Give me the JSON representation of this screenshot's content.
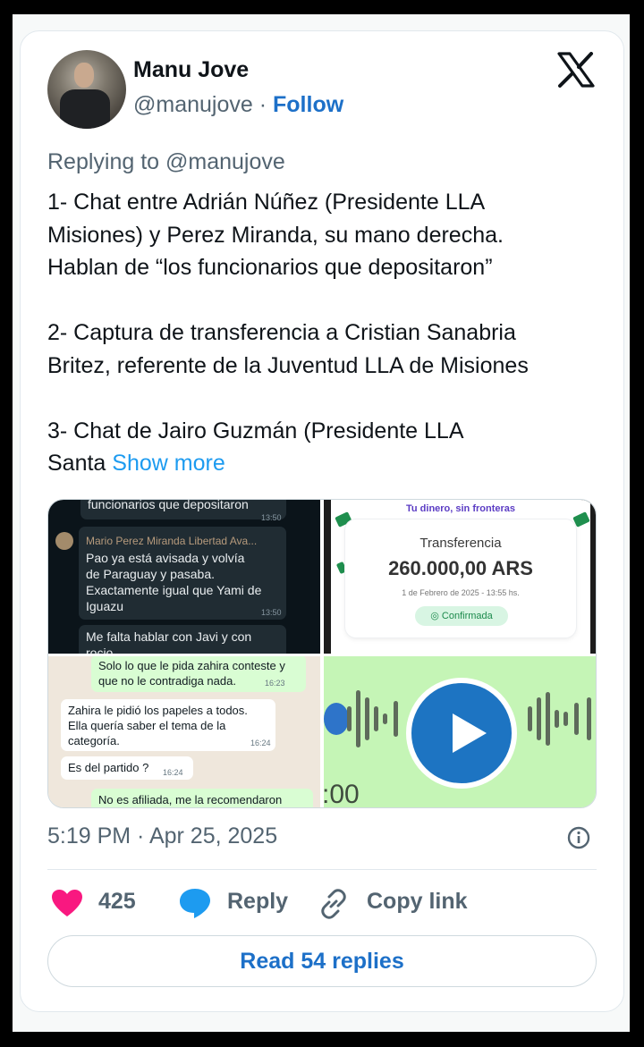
{
  "author": {
    "name": "Manu Jove",
    "handle": "@manujove",
    "separator": "·",
    "follow_label": "Follow"
  },
  "logo_icon": "x-logo-icon",
  "replying_to": "Replying to @manujove",
  "text": {
    "line1": "1- Chat entre Adrián Núñez (Presidente LLA",
    "line2": "Misiones) y Perez Miranda, su mano derecha.",
    "line3": "Hablan de “los funcionarios que depositaron”",
    "line4": "2- Captura de transferencia a Cristian Sanabria",
    "line5": "Britez, referente de la Juventud LLA de Misiones",
    "line6": "3- Chat de Jairo Guzmán (Presidente LLA",
    "line7_start": "Santa",
    "show_more": "Show more"
  },
  "media": {
    "chat1": {
      "top_text": "funcionarios que depositaron",
      "top_time": "13:50",
      "sender": "Mario Perez Miranda Libertad Ava...",
      "msg_l1": "Pao ya está avisada y volvía",
      "msg_l2": "de Paraguay y pasaba.",
      "msg_l3": "Exactamente igual que Yami de",
      "msg_l4": "Iguazu",
      "msg_time": "13:50",
      "bottom_l1": "Me falta hablar con Javi y con",
      "bottom_l2": "rocio"
    },
    "transfer": {
      "header": "Tu dinero, sin fronteras",
      "label": "Transferencia",
      "amount": "260.000,00 ARS",
      "date": "1 de Febrero de 2025 - 13:55 hs.",
      "status": "Confirmada"
    },
    "chat2": {
      "m1_l1": "Solo lo que le pida zahira  conteste y",
      "m1_l2": "que no le contradiga nada.",
      "m1_time": "16:23",
      "m2_l1": "Zahira le pidió los papeles a todos.",
      "m2_l2": "Ella quería saber el tema de la",
      "m2_l3": "categoría.",
      "m2_time": "16:24",
      "m3": "Es del partido ?",
      "m3_time": "16:24",
      "m4": "No es afiliada, me la recomendaron"
    },
    "audio": {
      "duration": ":00",
      "play_icon": "play-icon"
    }
  },
  "timestamp": "5:19 PM · Apr 25, 2025",
  "actions": {
    "like_count": "425",
    "reply_label": "Reply",
    "copy_link_label": "Copy link",
    "like_color": "#f91880",
    "reply_color": "#1d9bf0"
  },
  "read_replies_label": "Read 54 replies"
}
